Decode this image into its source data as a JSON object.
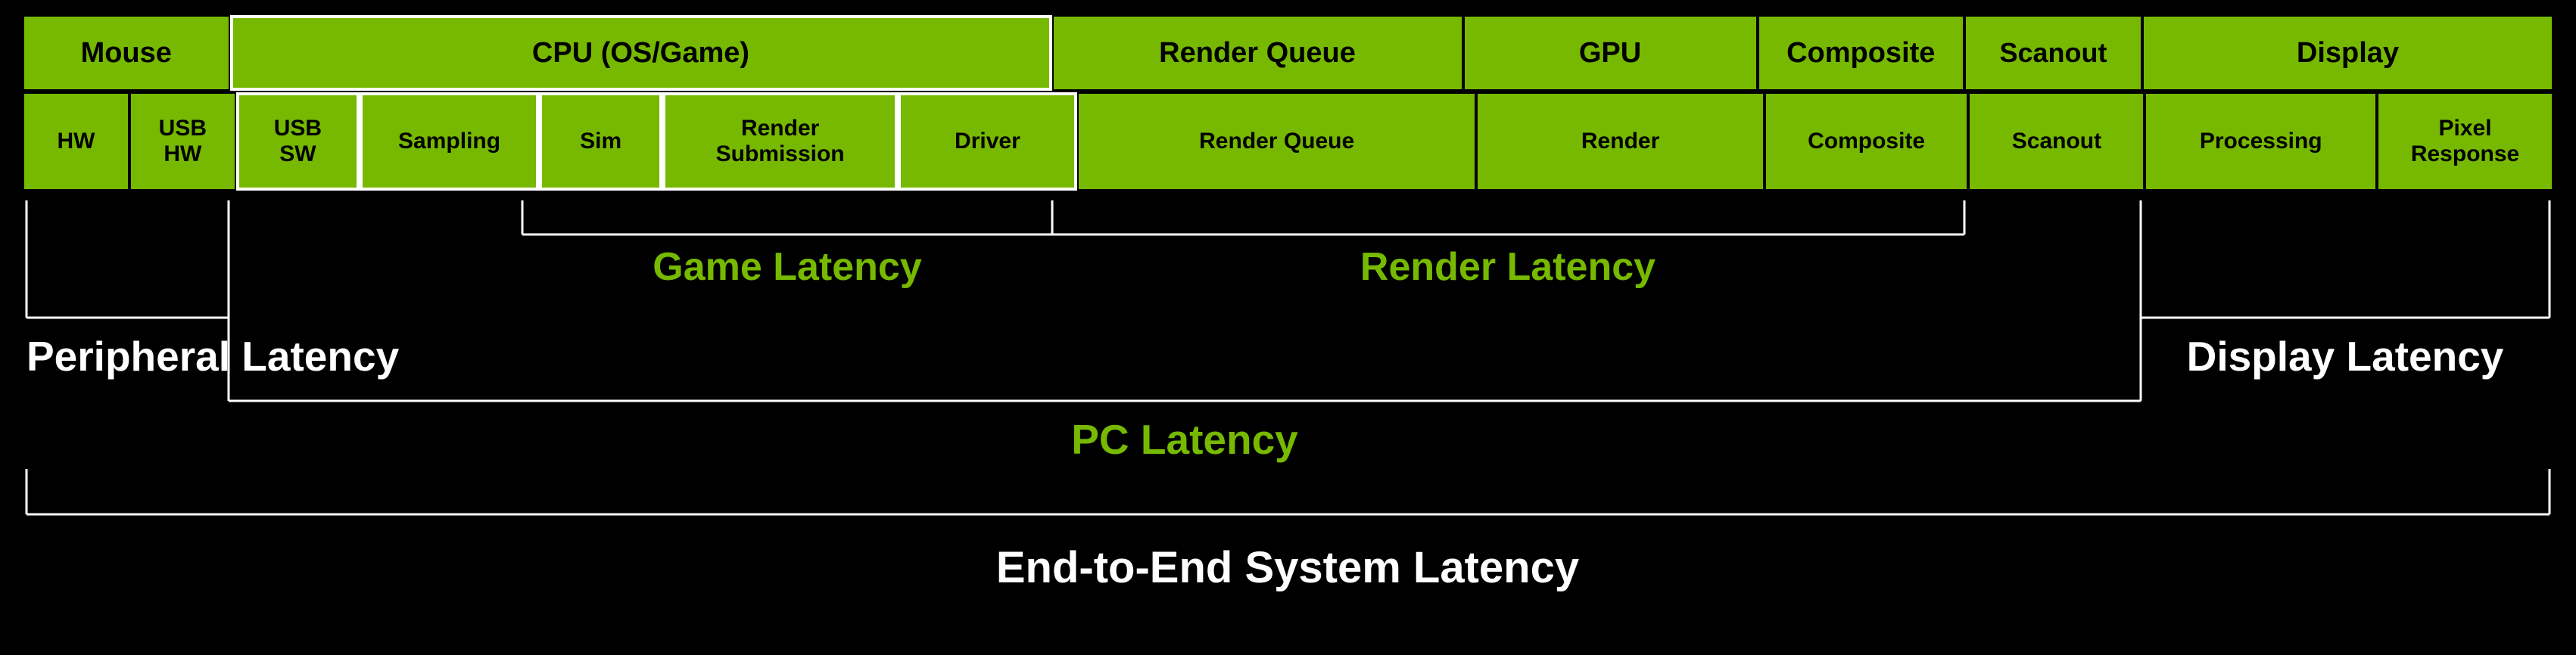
{
  "colors": {
    "green": "#76b900",
    "black": "#000000",
    "white": "#ffffff"
  },
  "categories": [
    {
      "label": "Mouse",
      "flex": 3.5
    },
    {
      "label": "CPU (OS/Game)",
      "flex": 14,
      "whiteBorder": true
    },
    {
      "label": "Render Queue",
      "flex": 7
    },
    {
      "label": "GPU",
      "flex": 5
    },
    {
      "label": "Composite",
      "flex": 3.5
    },
    {
      "label": "Scanout",
      "flex": 3
    },
    {
      "label": "Display",
      "flex": 7
    }
  ],
  "subItems": [
    {
      "label": "HW",
      "flex": 1.75
    },
    {
      "label": "USB\nHW",
      "flex": 1.75
    },
    {
      "label": "USB\nSW",
      "flex": 2,
      "whiteBorder": true
    },
    {
      "label": "Sampling",
      "flex": 3,
      "whiteBorder": true
    },
    {
      "label": "Sim",
      "flex": 2,
      "whiteBorder": true
    },
    {
      "label": "Render\nSubmission",
      "flex": 4,
      "whiteBorder": true
    },
    {
      "label": "Driver",
      "flex": 3,
      "whiteBorder": true
    },
    {
      "label": "Render Queue",
      "flex": 7
    },
    {
      "label": "Render",
      "flex": 5
    },
    {
      "label": "Composite",
      "flex": 3.5
    },
    {
      "label": "Scanout",
      "flex": 3
    },
    {
      "label": "Processing",
      "flex": 4
    },
    {
      "label": "Pixel\nResponse",
      "flex": 3
    }
  ],
  "latencyLabels": {
    "gameLatency": "Game Latency",
    "renderLatency": "Render Latency",
    "peripheralLatency": "Peripheral Latency",
    "pcLatency": "PC Latency",
    "displayLatency": "Display Latency",
    "endToEnd": "End-to-End System Latency"
  }
}
